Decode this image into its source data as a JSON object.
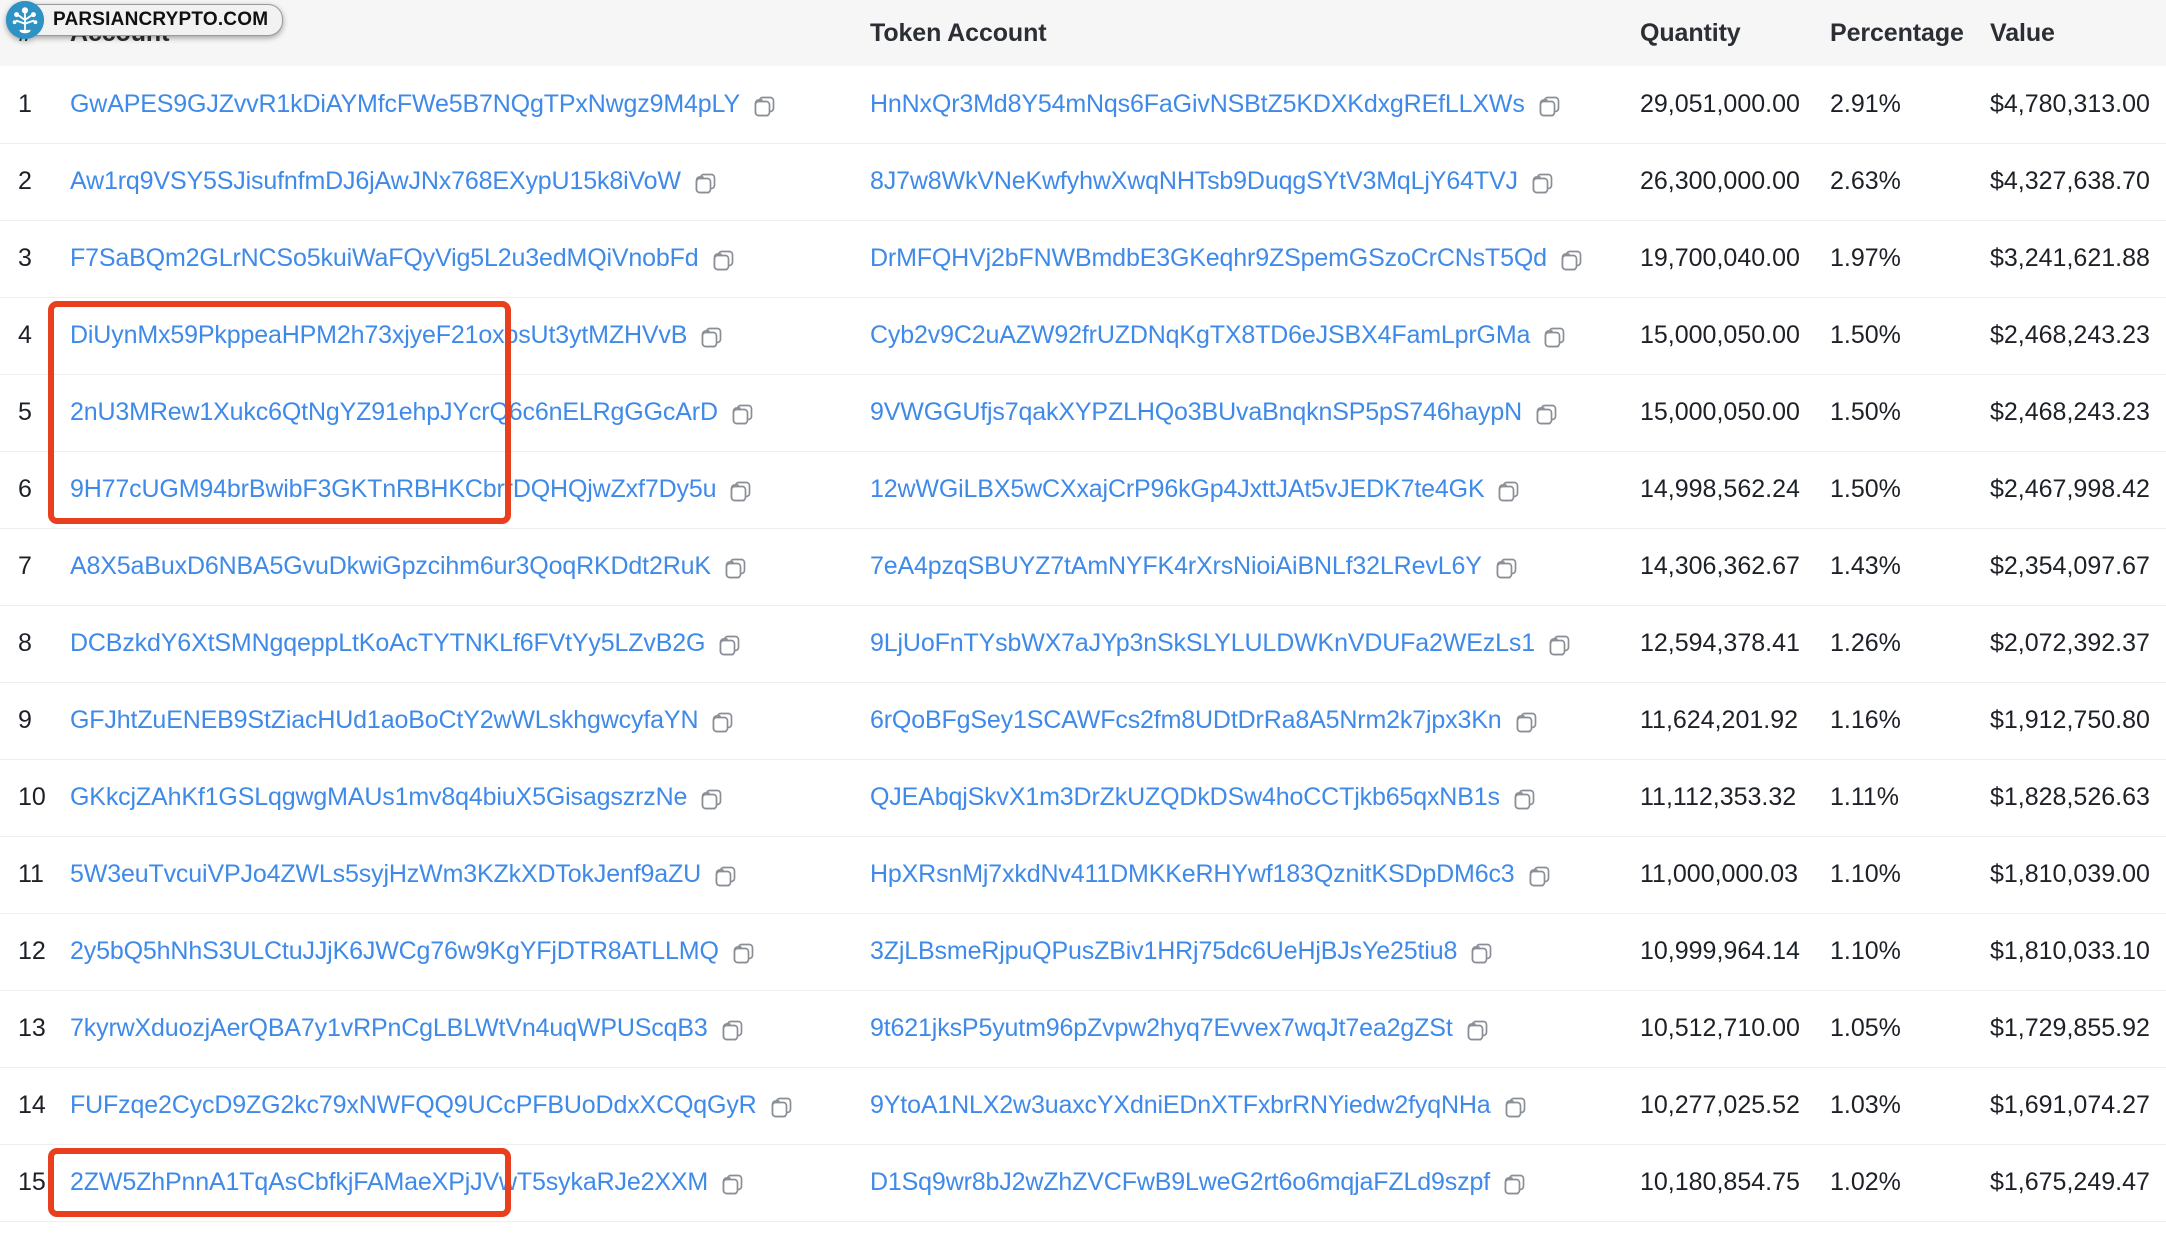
{
  "watermark": {
    "text": "PARSIANCRYPTO.COM",
    "logo_color": "#2e93c4"
  },
  "colors": {
    "link": "#3f8ae8",
    "highlight": "#e8401f",
    "header_bg": "#f6f6f7",
    "text": "#1d2127"
  },
  "table": {
    "headers": {
      "rank": "#",
      "account": "Account",
      "token_account": "Token Account",
      "quantity": "Quantity",
      "percentage": "Percentage",
      "value": "Value"
    },
    "rows": [
      {
        "rank": "1",
        "account": "GwAPES9GJZvvR1kDiAYMfcFWe5B7NQgTPxNwgz9M4pLY",
        "token_account": "HnNxQr3Md8Y54mNqs6FaGivNSBtZ5KDXKdxgREfLLXWs",
        "quantity": "29,051,000.00",
        "percentage": "2.91%",
        "value": "$4,780,313.00",
        "highlighted": false
      },
      {
        "rank": "2",
        "account": "Aw1rq9VSY5SJisufnfmDJ6jAwJNx768EXypU15k8iVoW",
        "token_account": "8J7w8WkVNeKwfyhwXwqNHTsb9DuqgSYtV3MqLjY64TVJ",
        "quantity": "26,300,000.00",
        "percentage": "2.63%",
        "value": "$4,327,638.70",
        "highlighted": false
      },
      {
        "rank": "3",
        "account": "F7SaBQm2GLrNCSo5kuiWaFQyVig5L2u3edMQiVnobFd",
        "token_account": "DrMFQHVj2bFNWBmdbE3GKeqhr9ZSpemGSzoCrCNsT5Qd",
        "quantity": "19,700,040.00",
        "percentage": "1.97%",
        "value": "$3,241,621.88",
        "highlighted": false
      },
      {
        "rank": "4",
        "account": "DiUynMx59PkppeaHPM2h73xjyeF21oxosUt3ytMZHVvB",
        "token_account": "Cyb2v9C2uAZW92frUZDNqKgTX8TD6eJSBX4FamLprGMa",
        "quantity": "15,000,050.00",
        "percentage": "1.50%",
        "value": "$2,468,243.23",
        "highlighted": true
      },
      {
        "rank": "5",
        "account": "2nU3MRew1Xukc6QtNgYZ91ehpJYcrQ6c6nELRgGGcArD",
        "token_account": "9VWGGUfjs7qakXYPZLHQo3BUvaBnqknSP5pS746haypN",
        "quantity": "15,000,050.00",
        "percentage": "1.50%",
        "value": "$2,468,243.23",
        "highlighted": true
      },
      {
        "rank": "6",
        "account": "9H77cUGM94brBwibF3GKTnRBHKCbrrDQHQjwZxf7Dy5u",
        "token_account": "12wWGiLBX5wCXxajCrP96kGp4JxttJAt5vJEDK7te4GK",
        "quantity": "14,998,562.24",
        "percentage": "1.50%",
        "value": "$2,467,998.42",
        "highlighted": true
      },
      {
        "rank": "7",
        "account": "A8X5aBuxD6NBA5GvuDkwiGpzcihm6ur3QoqRKDdt2RuK",
        "token_account": "7eA4pzqSBUYZ7tAmNYFK4rXrsNioiAiBNLf32LRevL6Y",
        "quantity": "14,306,362.67",
        "percentage": "1.43%",
        "value": "$2,354,097.67",
        "highlighted": false
      },
      {
        "rank": "8",
        "account": "DCBzkdY6XtSMNgqeppLtKoAcTYTNKLf6FVtYy5LZvB2G",
        "token_account": "9LjUoFnTYsbWX7aJYp3nSkSLYLULDWKnVDUFa2WEzLs1",
        "quantity": "12,594,378.41",
        "percentage": "1.26%",
        "value": "$2,072,392.37",
        "highlighted": false
      },
      {
        "rank": "9",
        "account": "GFJhtZuENEB9StZiacHUd1aoBoCtY2wWLskhgwcyfaYN",
        "token_account": "6rQoBFgSey1SCAWFcs2fm8UDtDrRa8A5Nrm2k7jpx3Kn",
        "quantity": "11,624,201.92",
        "percentage": "1.16%",
        "value": "$1,912,750.80",
        "highlighted": false
      },
      {
        "rank": "10",
        "account": "GKkcjZAhKf1GSLqgwgMAUs1mv8q4biuX5GisagszrzNe",
        "token_account": "QJEAbqjSkvX1m3DrZkUZQDkDSw4hoCCTjkb65qxNB1s",
        "quantity": "11,112,353.32",
        "percentage": "1.11%",
        "value": "$1,828,526.63",
        "highlighted": false
      },
      {
        "rank": "11",
        "account": "5W3euTvcuiVPJo4ZWLs5syjHzWm3KZkXDTokJenf9aZU",
        "token_account": "HpXRsnMj7xkdNv411DMKKeRHYwf183QznitKSDpDM6c3",
        "quantity": "11,000,000.03",
        "percentage": "1.10%",
        "value": "$1,810,039.00",
        "highlighted": false
      },
      {
        "rank": "12",
        "account": "2y5bQ5hNhS3ULCtuJJjK6JWCg76w9KgYFjDTR8ATLLMQ",
        "token_account": "3ZjLBsmeRjpuQPusZBiv1HRj75dc6UeHjBJsYe25tiu8",
        "quantity": "10,999,964.14",
        "percentage": "1.10%",
        "value": "$1,810,033.10",
        "highlighted": false
      },
      {
        "rank": "13",
        "account": "7kyrwXduozjAerQBA7y1vRPnCgLBLWtVn4uqWPUScqB3",
        "token_account": "9t621jksP5yutm96pZvpw2hyq7Evvex7wqJt7ea2gZSt",
        "quantity": "10,512,710.00",
        "percentage": "1.05%",
        "value": "$1,729,855.92",
        "highlighted": false
      },
      {
        "rank": "14",
        "account": "FUFzqe2CycD9ZG2kc79xNWFQQ9UCcPFBUoDdxXCQqGyR",
        "token_account": "9YtoA1NLX2w3uaxcYXdniEDnXTFxbrRNYiedw2fyqNHa",
        "quantity": "10,277,025.52",
        "percentage": "1.03%",
        "value": "$1,691,074.27",
        "highlighted": false
      },
      {
        "rank": "15",
        "account": "2ZW5ZhPnnA1TqAsCbfkjFAMaeXPjJVwT5sykaRJe2XXM",
        "token_account": "D1Sq9wr8bJ2wZhZVCFwB9LweG2rt6o6mqjaFZLd9szpf",
        "quantity": "10,180,854.75",
        "percentage": "1.02%",
        "value": "$1,675,249.47",
        "highlighted": true
      }
    ]
  },
  "icons": {
    "copy": "copy-icon"
  }
}
